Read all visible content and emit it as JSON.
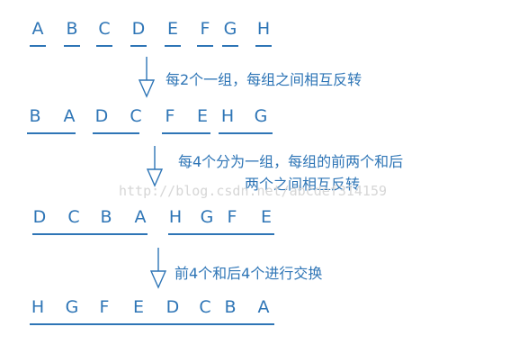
{
  "rows": [
    {
      "letters": [
        "A",
        "B",
        "C",
        "D",
        "E",
        "F",
        "G",
        "H"
      ]
    },
    {
      "letters": [
        "B",
        "A",
        "D",
        "C",
        "F",
        "E",
        "H",
        "G"
      ]
    },
    {
      "letters": [
        "D",
        "C",
        "B",
        "A",
        "H",
        "G",
        "F",
        "E"
      ]
    },
    {
      "letters": [
        "H",
        "G",
        "F",
        "E",
        "D",
        "C",
        "B",
        "A"
      ]
    }
  ],
  "steps": [
    {
      "text": "每2个一组，每组之间相互反转"
    },
    {
      "line1": "每4个分为一组，每组的前两个和后",
      "line2": "两个之间相互反转"
    },
    {
      "text": "前4个和后4个进行交换"
    }
  ],
  "watermark": "http://blog.csdn.net/abcdef314159",
  "colors": {
    "accent": "#2e75b6",
    "watermark": "#d6d6d6"
  }
}
